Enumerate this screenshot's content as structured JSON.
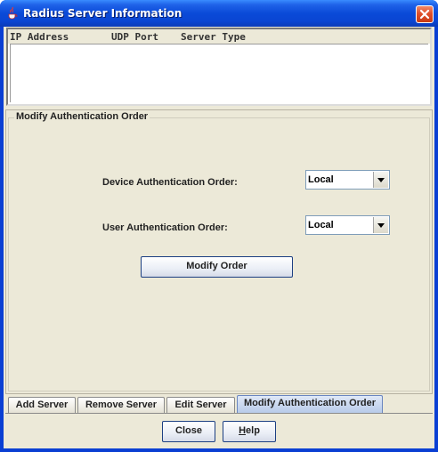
{
  "window": {
    "title": "Radius Server Information"
  },
  "table": {
    "columns": [
      "IP Address",
      "UDP Port",
      "Server Type"
    ],
    "rows": []
  },
  "group": {
    "title": "Modify Authentication Order",
    "device_label": "Device Authentication Order:",
    "device_value": "Local",
    "user_label": "User Authentication Order:",
    "user_value": "Local",
    "modify_button": "Modify Order"
  },
  "tabs": [
    {
      "label": "Add Server",
      "active": false
    },
    {
      "label": "Remove Server",
      "active": false
    },
    {
      "label": "Edit Server",
      "active": false
    },
    {
      "label": "Modify Authentication Order",
      "active": true
    }
  ],
  "footer": {
    "close_label": "Close",
    "help_prefix": "H",
    "help_rest": "elp"
  },
  "icons": {
    "app": "java-cup-icon",
    "close": "close-icon",
    "dropdown": "chevron-down-icon"
  }
}
